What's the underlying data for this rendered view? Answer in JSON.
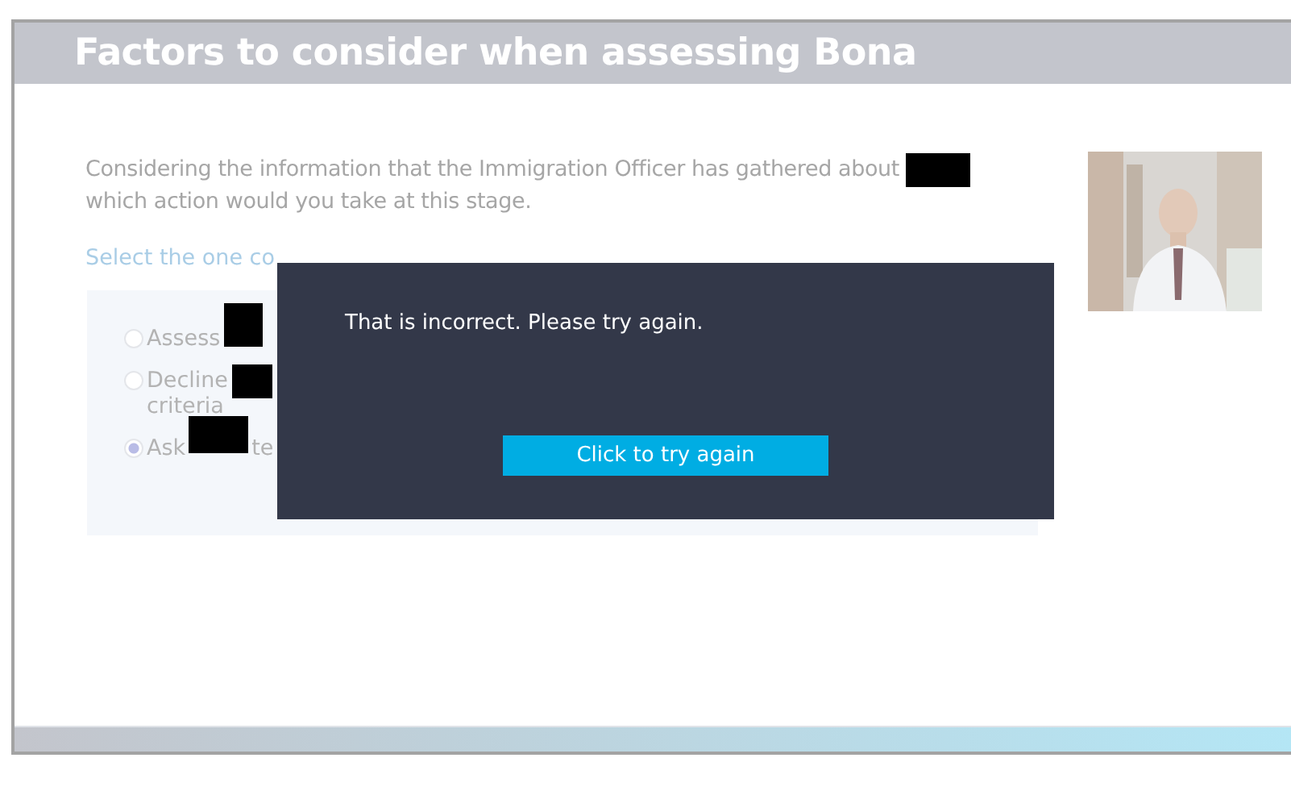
{
  "header": {
    "title": "Factors to consider when assessing Bona"
  },
  "question": {
    "text": "Considering the information that the Immigration Officer has gathered about",
    "text_after": "which action would you take at this stage."
  },
  "instruction": "Select the one co",
  "options": [
    {
      "lines": [
        "Assess"
      ],
      "selected": false
    },
    {
      "lines": [
        "Decline",
        "criteria"
      ],
      "selected": false
    },
    {
      "lines": [
        "Ask"
      ],
      "after": "te",
      "selected": true
    }
  ],
  "dialog": {
    "message": "That is incorrect. Please try again.",
    "button": "Click to try again"
  }
}
